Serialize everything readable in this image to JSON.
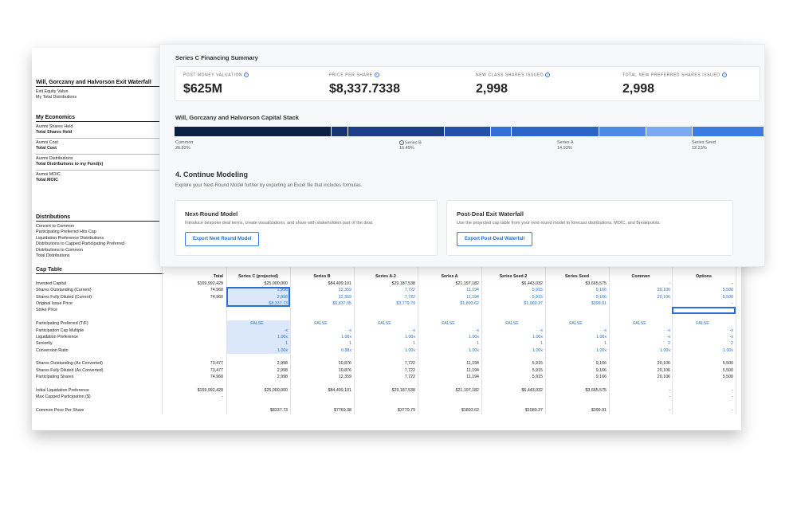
{
  "summary": {
    "title": "Series C Financing Summary",
    "metrics": [
      {
        "label": "POST MONEY VALUATION",
        "value": "$625M"
      },
      {
        "label": "PRICE PER SHARE",
        "value": "$8,337.7338"
      },
      {
        "label": "NEW CLASS SHARES ISSUED",
        "value": "2,998"
      },
      {
        "label": "TOTAL NEW PREFERRED SHARES ISSUED",
        "value": "2,998"
      }
    ]
  },
  "capital_stack": {
    "title": "Will, Gorczany and Halvorson Capital Stack",
    "segments": [
      {
        "name": "Common",
        "pct": "26.82%",
        "share": 26.82,
        "color": "#0c1f45"
      },
      {
        "name": "Series B",
        "pct": "16.49%",
        "share": 16.49,
        "color": "#1b3f86"
      },
      {
        "name": "Series A",
        "pct": "14.93%",
        "share": 14.93,
        "color": "#2d64c8"
      },
      {
        "name": "Series Seed",
        "pct": "12.23%",
        "share": 12.23,
        "color": "#3c7be0"
      }
    ],
    "unlabeled_segments": [
      {
        "share": 2.7,
        "color": "#163372"
      },
      {
        "share": 7.7,
        "color": "#2451a7"
      },
      {
        "share": 3.4,
        "color": "#3470d8"
      },
      {
        "share": 7.9,
        "color": "#4d8ae6"
      },
      {
        "share": 7.8,
        "color": "#7aaaf0"
      }
    ]
  },
  "continue": {
    "title": "4. Continue Modeling",
    "subtitle": "Explore your Next-Round Model further by exporting an Excel file that includes formulas.",
    "cards": [
      {
        "title": "Next-Round Model",
        "desc": "Introduce bespoke deal terms, create visualizations, and share with stakeholders part of the deal.",
        "button": "Export Next Round Model"
      },
      {
        "title": "Post-Deal Exit Waterfall",
        "desc": "Use the projected cap table from your next-round model to forecast distributions, MOIC, and Breakpoints.",
        "button": "Export Post-Deal Waterfall"
      }
    ]
  },
  "left_panel": {
    "waterfall_title": "Will, Gorczany and Halvorson Exit Waterfall",
    "waterfall_rows": [
      "Exit Equity Value",
      "My Total Distributions"
    ],
    "econ_title": "My Economics",
    "econ_rows": [
      {
        "label": "Aumni Shares Held",
        "bold": false
      },
      {
        "label": "Total Shares Held",
        "bold": true
      },
      {
        "label": "Aumni Cost",
        "bold": false,
        "sep": true
      },
      {
        "label": "Total Cost",
        "bold": true
      },
      {
        "label": "Aumni Distributions",
        "bold": false,
        "sep": true
      },
      {
        "label": "Total Distributions to my Fund(s)",
        "bold": true
      },
      {
        "label": "Aumni MOIC",
        "bold": false,
        "sep": true
      },
      {
        "label": "Total MOIC",
        "bold": true
      }
    ],
    "dist_title": "Distributions",
    "dist_rows": [
      "Convert to Common",
      "Participating Preferred Hits Cap",
      "Liquidation Preference Distributions",
      "Distributions to Capped Participating Preferred",
      "Distributions to Common",
      "Total Distributions"
    ]
  },
  "cap_table": {
    "title": "Cap Table",
    "columns": [
      "Total",
      "Series C (projected)",
      "Series B",
      "Series A-2",
      "Series A",
      "Series Seed-2",
      "Series Seed",
      "Common",
      "Options"
    ],
    "rows": [
      {
        "label": "Invested Capital",
        "cells": [
          "$169,992,429",
          "$25,000,000",
          "$84,499,101",
          "$29,187,538",
          "$21,197,182",
          "$6,443,032",
          "$3,665,575",
          "-",
          "-"
        ]
      },
      {
        "label": "Shares Outstanding (Current)",
        "cells": [
          "74,960",
          "2,998",
          "12,359",
          "7,722",
          "11,194",
          "5,915",
          "9,166",
          "20,106",
          "5,500"
        ]
      },
      {
        "label": "Shares Fully Diluted (Current)",
        "cells": [
          "74,960",
          "2,998",
          "12,359",
          "7,722",
          "11,194",
          "5,915",
          "9,166",
          "20,106",
          "5,500"
        ]
      },
      {
        "label": "Original Issue Price",
        "cells": [
          "",
          "$8,337.73",
          "$6,837.05",
          "$3,779.79",
          "$1,893.62",
          "$1,089.27",
          "$399.91",
          "",
          "-"
        ]
      },
      {
        "label": "Strike Price",
        "cells": [
          "",
          "",
          "",
          "",
          "",
          "",
          "",
          "",
          ""
        ]
      },
      {
        "gap": true
      },
      {
        "label": "Participating Preferred (T/F)",
        "cells": [
          "",
          "FALSE",
          "FALSE",
          "FALSE",
          "FALSE",
          "FALSE",
          "FALSE",
          "FALSE",
          "FALSE"
        ]
      },
      {
        "label": "Participation Cap Multiple",
        "cells": [
          "",
          "-x",
          "-x",
          "-x",
          "-x",
          "-x",
          "-x",
          "-x",
          "-x"
        ]
      },
      {
        "label": "Liquidation Preference",
        "cells": [
          "",
          "1.00x",
          "1.00x",
          "1.00x",
          "1.00x",
          "1.00x",
          "1.00x",
          "-x",
          "-x"
        ]
      },
      {
        "label": "Seniority",
        "cells": [
          "",
          "1",
          "1",
          "1",
          "1",
          "1",
          "1",
          "2",
          "2"
        ]
      },
      {
        "label": "Conversion Ratio",
        "cells": [
          "",
          "1.00x",
          "0.88x",
          "1.00x",
          "1.00x",
          "1.00x",
          "1.00x",
          "1.00x",
          "1.00x"
        ]
      },
      {
        "gap": true
      },
      {
        "label": "Shares Outstanding (As Converted)",
        "cells": [
          "73,477",
          "2,998",
          "10,876",
          "7,722",
          "11,194",
          "5,915",
          "9,166",
          "20,106",
          "5,500"
        ]
      },
      {
        "label": "Shares Fully Diluted (As Converted)",
        "cells": [
          "73,477",
          "2,998",
          "10,876",
          "7,722",
          "11,194",
          "5,915",
          "9,166",
          "20,106",
          "5,500"
        ]
      },
      {
        "label": "Participating Shares",
        "cells": [
          "74,960",
          "2,998",
          "12,359",
          "7,722",
          "11,194",
          "5,915",
          "9,166",
          "20,106",
          "5,500"
        ]
      },
      {
        "gap": true
      },
      {
        "label": "Initial Liquidation Preference",
        "cells": [
          "$169,992,429",
          "$25,000,000",
          "$84,499,101",
          "$29,187,538",
          "$21,197,182",
          "$6,443,032",
          "$3,665,575",
          "-",
          "-"
        ]
      },
      {
        "label": "Max Capped Participation ($)",
        "cells": [
          "-",
          "",
          "",
          "",
          "",
          "",
          "",
          "-",
          "-"
        ]
      },
      {
        "gap": true
      },
      {
        "label": "Common Price Per Share",
        "cells": [
          "",
          "$8337.73",
          "$7769.38",
          "$3779.79",
          "$1893.62",
          "$1089.27",
          "$399.91",
          "-",
          "-"
        ]
      }
    ]
  }
}
